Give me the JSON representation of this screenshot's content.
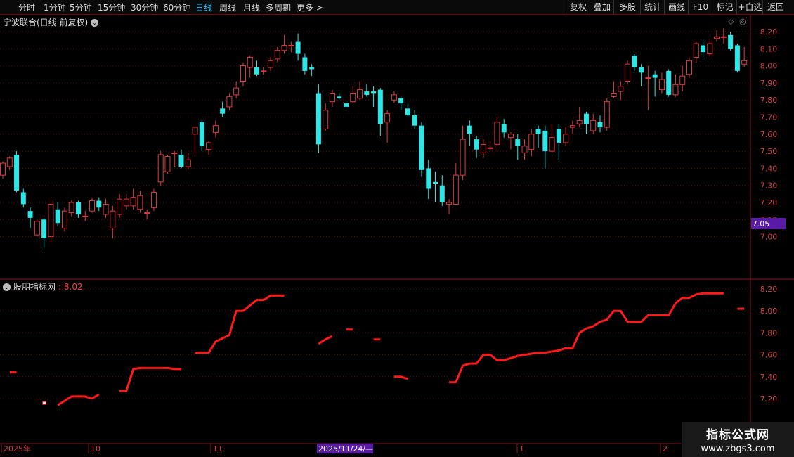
{
  "toolbar": {
    "left_items": [
      "分时",
      "1分钟",
      "5分钟",
      "15分钟",
      "30分钟",
      "60分钟",
      "日线",
      "周线",
      "月线",
      "多周期",
      "更多 >"
    ],
    "active": "日线",
    "right_items": [
      "复权",
      "叠加",
      "多股",
      "统计",
      "画线",
      "F10",
      "标记",
      "+自选",
      "返回"
    ]
  },
  "main_title": "宁波联合(日线 前复权)",
  "price_axis": [
    "8.20",
    "8.10",
    "8.00",
    "7.90",
    "7.80",
    "7.70",
    "7.60",
    "7.50",
    "7.40",
    "7.30",
    "7.20",
    "7.10",
    "7.00"
  ],
  "current_price_tag": "7.05",
  "indicator": {
    "title": "股朋指标网",
    "value": ": 8.02"
  },
  "indicator_axis": [
    "8.20",
    "8.00",
    "7.80",
    "7.60",
    "7.40",
    "7.20"
  ],
  "date_axis": [
    {
      "label": "2025年",
      "highlight": false
    },
    {
      "label": "10",
      "highlight": false
    },
    {
      "label": "11",
      "highlight": false
    },
    {
      "label": "2025/11/24/—",
      "highlight": true
    },
    {
      "label": "1",
      "highlight": false
    },
    {
      "label": "2",
      "highlight": false
    }
  ],
  "watermark": {
    "line1": "指标公式网",
    "line2": "www.zbgs3.com"
  },
  "colors": {
    "up": "#e03c3c",
    "down": "#2ee6e6",
    "indicator": "#ff1a1a",
    "grid": "#5a1010",
    "tag_bg": "#5a1aa8"
  },
  "chart_data": {
    "type": "candlestick",
    "y_range": [
      6.95,
      8.25
    ],
    "candles": [
      [
        7.36,
        7.43,
        7.44,
        7.34
      ],
      [
        7.41,
        7.46,
        7.47,
        7.39
      ],
      [
        7.48,
        7.27,
        7.5,
        7.26
      ],
      [
        7.26,
        7.19,
        7.28,
        7.17
      ],
      [
        7.15,
        7.11,
        7.17,
        7.05
      ],
      [
        7.01,
        7.09,
        7.1,
        7.0
      ],
      [
        7.1,
        6.99,
        7.11,
        6.93
      ],
      [
        7.0,
        7.19,
        7.22,
        6.97
      ],
      [
        7.16,
        7.08,
        7.2,
        7.06
      ],
      [
        7.05,
        7.15,
        7.17,
        7.03
      ],
      [
        7.14,
        7.2,
        7.21,
        7.12
      ],
      [
        7.2,
        7.13,
        7.21,
        7.11
      ],
      [
        7.12,
        7.12,
        7.15,
        7.09
      ],
      [
        7.15,
        7.21,
        7.23,
        7.14
      ],
      [
        7.21,
        7.17,
        7.23,
        7.15
      ],
      [
        7.13,
        7.19,
        7.22,
        7.11
      ],
      [
        7.05,
        7.15,
        7.18,
        6.99
      ],
      [
        7.13,
        7.22,
        7.25,
        7.11
      ],
      [
        7.18,
        7.22,
        7.25,
        7.16
      ],
      [
        7.18,
        7.23,
        7.28,
        7.16
      ],
      [
        7.16,
        7.24,
        7.27,
        7.14
      ],
      [
        7.14,
        7.14,
        7.16,
        7.1
      ],
      [
        7.17,
        7.26,
        7.28,
        7.15
      ],
      [
        7.32,
        7.48,
        7.5,
        7.3
      ],
      [
        7.38,
        7.47,
        7.48,
        7.37
      ],
      [
        7.49,
        7.49,
        7.5,
        7.41
      ],
      [
        7.48,
        7.41,
        7.51,
        7.4
      ],
      [
        7.41,
        7.45,
        7.49,
        7.39
      ],
      [
        7.6,
        7.64,
        7.65,
        7.48
      ],
      [
        7.67,
        7.53,
        7.68,
        7.5
      ],
      [
        7.51,
        7.55,
        7.56,
        7.48
      ],
      [
        7.61,
        7.65,
        7.68,
        7.58
      ],
      [
        7.75,
        7.72,
        7.79,
        7.7
      ],
      [
        7.76,
        7.82,
        7.84,
        7.74
      ],
      [
        7.83,
        7.87,
        7.91,
        7.81
      ],
      [
        7.91,
        8.0,
        8.02,
        7.88
      ],
      [
        7.99,
        8.05,
        8.06,
        7.93
      ],
      [
        7.99,
        7.95,
        8.03,
        7.94
      ],
      [
        7.97,
        7.97,
        7.99,
        7.95
      ],
      [
        7.99,
        8.03,
        8.05,
        7.97
      ],
      [
        8.04,
        8.09,
        8.11,
        8.02
      ],
      [
        8.09,
        8.12,
        8.18,
        8.07
      ],
      [
        8.12,
        8.12,
        8.14,
        8.08
      ],
      [
        8.14,
        8.07,
        8.19,
        8.03
      ],
      [
        8.05,
        7.97,
        8.07,
        7.95
      ],
      [
        7.99,
        7.98,
        8.01,
        7.94
      ],
      [
        7.84,
        7.54,
        7.89,
        7.49
      ],
      [
        7.63,
        7.74,
        7.78,
        7.62
      ],
      [
        7.79,
        7.84,
        7.86,
        7.76
      ],
      [
        7.82,
        7.81,
        7.84,
        7.8
      ],
      [
        7.78,
        7.76,
        7.79,
        7.75
      ],
      [
        7.79,
        7.84,
        7.88,
        7.78
      ],
      [
        7.81,
        7.86,
        7.91,
        7.8
      ],
      [
        7.85,
        7.83,
        7.89,
        7.82
      ],
      [
        7.85,
        7.84,
        7.88,
        7.76
      ],
      [
        7.86,
        7.66,
        7.87,
        7.59
      ],
      [
        7.67,
        7.72,
        7.74,
        7.55
      ],
      [
        7.8,
        7.83,
        7.85,
        7.78
      ],
      [
        7.81,
        7.78,
        7.82,
        7.74
      ],
      [
        7.75,
        7.71,
        7.78,
        7.7
      ],
      [
        7.71,
        7.65,
        7.74,
        7.63
      ],
      [
        7.65,
        7.39,
        7.67,
        7.35
      ],
      [
        7.4,
        7.28,
        7.45,
        7.22
      ],
      [
        7.32,
        7.31,
        7.38,
        7.2
      ],
      [
        7.3,
        7.2,
        7.36,
        7.18
      ],
      [
        7.19,
        7.2,
        7.22,
        7.13
      ],
      [
        7.19,
        7.36,
        7.43,
        7.19
      ],
      [
        7.36,
        7.57,
        7.65,
        7.33
      ],
      [
        7.65,
        7.6,
        7.68,
        7.53
      ],
      [
        7.57,
        7.51,
        7.59,
        7.46
      ],
      [
        7.49,
        7.54,
        7.57,
        7.46
      ],
      [
        7.52,
        7.52,
        7.56,
        7.51
      ],
      [
        7.54,
        7.67,
        7.7,
        7.5
      ],
      [
        7.66,
        7.61,
        7.69,
        7.58
      ],
      [
        7.58,
        7.6,
        7.61,
        7.51
      ],
      [
        7.57,
        7.53,
        7.6,
        7.45
      ],
      [
        7.49,
        7.53,
        7.57,
        7.45
      ],
      [
        7.51,
        7.6,
        7.63,
        7.47
      ],
      [
        7.63,
        7.6,
        7.65,
        7.52
      ],
      [
        7.62,
        7.5,
        7.65,
        7.4
      ],
      [
        7.5,
        7.58,
        7.66,
        7.49
      ],
      [
        7.63,
        7.55,
        7.66,
        7.45
      ],
      [
        7.55,
        7.6,
        7.64,
        7.53
      ],
      [
        7.64,
        7.65,
        7.68,
        7.6
      ],
      [
        7.66,
        7.68,
        7.76,
        7.64
      ],
      [
        7.72,
        7.66,
        7.73,
        7.6
      ],
      [
        7.62,
        7.68,
        7.72,
        7.6
      ],
      [
        7.67,
        7.64,
        7.71,
        7.61
      ],
      [
        7.64,
        7.79,
        7.81,
        7.62
      ],
      [
        7.82,
        7.84,
        7.91,
        7.81
      ],
      [
        7.85,
        7.88,
        7.91,
        7.8
      ],
      [
        7.91,
        8.01,
        8.03,
        7.89
      ],
      [
        8.06,
        7.99,
        8.07,
        7.97
      ],
      [
        7.99,
        7.96,
        8.01,
        7.88
      ],
      [
        7.93,
        7.93,
        8.0,
        7.74
      ],
      [
        7.95,
        7.93,
        7.97,
        7.82
      ],
      [
        7.86,
        7.92,
        7.96,
        7.84
      ],
      [
        7.97,
        7.83,
        7.98,
        7.82
      ],
      [
        7.83,
        7.89,
        7.95,
        7.82
      ],
      [
        7.89,
        7.94,
        8.0,
        7.85
      ],
      [
        7.95,
        8.03,
        8.05,
        7.93
      ],
      [
        8.05,
        8.13,
        8.14,
        8.02
      ],
      [
        8.12,
        8.08,
        8.15,
        8.05
      ],
      [
        8.07,
        8.13,
        8.16,
        8.05
      ],
      [
        8.16,
        8.17,
        8.21,
        8.14
      ],
      [
        8.17,
        8.17,
        8.22,
        8.13
      ],
      [
        8.18,
        8.1,
        8.2,
        8.09
      ],
      [
        8.12,
        7.97,
        8.13,
        7.96
      ],
      [
        8.01,
        8.03,
        8.11,
        7.99
      ]
    ],
    "indicator_series": [
      null,
      7.44,
      7.44,
      null,
      null,
      null,
      7.16,
      null,
      7.14,
      7.18,
      7.22,
      7.22,
      7.22,
      7.2,
      7.24,
      null,
      null,
      7.27,
      7.27,
      7.47,
      7.48,
      7.48,
      7.48,
      7.48,
      7.48,
      7.47,
      7.47,
      null,
      7.62,
      7.62,
      7.62,
      7.72,
      7.75,
      7.78,
      8.0,
      8.0,
      8.05,
      8.1,
      8.1,
      8.14,
      8.14,
      8.14,
      null,
      null,
      null,
      null,
      7.7,
      7.74,
      7.77,
      null,
      7.83,
      7.83,
      null,
      null,
      7.74,
      7.74,
      null,
      7.4,
      7.4,
      7.38,
      null,
      null,
      null,
      null,
      null,
      7.35,
      7.35,
      7.5,
      7.52,
      7.52,
      7.6,
      7.6,
      7.55,
      7.55,
      7.57,
      7.59,
      7.6,
      7.61,
      7.62,
      7.62,
      7.63,
      7.64,
      7.66,
      7.66,
      7.8,
      7.84,
      7.86,
      7.9,
      7.92,
      8.0,
      8.0,
      7.9,
      7.9,
      7.9,
      7.96,
      7.96,
      7.96,
      7.96,
      8.07,
      8.12,
      8.12,
      8.15,
      8.16,
      8.16,
      8.16,
      8.16,
      null,
      8.02,
      8.02
    ],
    "x_range_days": 109
  }
}
